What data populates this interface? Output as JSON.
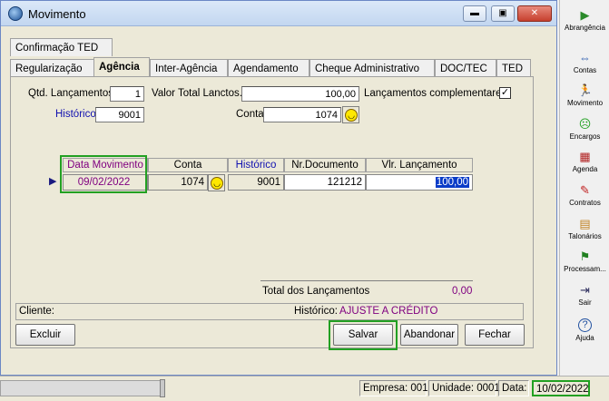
{
  "window": {
    "title": "Movimento",
    "buttons": {
      "minimize": "▬",
      "maximize": "▣",
      "close": "✕"
    }
  },
  "tabs_row1": [
    {
      "label": "Confirmação TED"
    }
  ],
  "tabs_row2": [
    {
      "label": "Regularização"
    },
    {
      "label": "Agência"
    },
    {
      "label": "Inter-Agência"
    },
    {
      "label": "Agendamento"
    },
    {
      "label": "Cheque Administrativo"
    },
    {
      "label": "DOC/TEC"
    },
    {
      "label": "TED"
    }
  ],
  "form": {
    "qtd_label": "Qtd. Lançamentos",
    "qtd_value": "1",
    "valor_label": "Valor Total Lanctos.",
    "valor_value": "100,00",
    "complementares_label": "Lançamentos complementares",
    "complementares_checked": "✓",
    "historico_label": "Histórico",
    "historico_value": "9001",
    "conta_label": "Conta",
    "conta_value": "1074"
  },
  "grid": {
    "headers": [
      "Data Movimento",
      "Conta",
      "Histórico",
      "Nr.Documento",
      "Vlr. Lançamento"
    ],
    "row": {
      "data": "09/02/2022",
      "conta": "1074",
      "historico": "9001",
      "nr_documento": "121212",
      "vlr": "100,00"
    },
    "row_indicator": "▶"
  },
  "total": {
    "label": "Total dos Lançamentos",
    "value": "0,00"
  },
  "cliente": {
    "label": "Cliente:",
    "historico_label": "Histórico:",
    "historico_value": "AJUSTE A CRÉDITO"
  },
  "buttons": {
    "excluir": "Excluir",
    "salvar": "Salvar",
    "abandonar": "Abandonar",
    "fechar": "Fechar"
  },
  "sidebar": [
    {
      "label": "Abrangência",
      "icon": "abrangencia-icon",
      "glyph": "▶",
      "color": "#2a8a2a"
    },
    {
      "label": "Contas",
      "icon": "contas-icon",
      "glyph": "⇔",
      "color": "#3060b0"
    },
    {
      "label": "Movimento",
      "icon": "movimento-icon",
      "glyph": "🏃",
      "color": "#1a1a80"
    },
    {
      "label": "Encargos",
      "icon": "encargos-icon",
      "glyph": "☹",
      "color": "#20a020"
    },
    {
      "label": "Agenda",
      "icon": "agenda-icon",
      "glyph": "▦",
      "color": "#b02020"
    },
    {
      "label": "Contratos",
      "icon": "contratos-icon",
      "glyph": "✎",
      "color": "#c02020"
    },
    {
      "label": "Talonários",
      "icon": "talonarios-icon",
      "glyph": "▤",
      "color": "#c08020"
    },
    {
      "label": "Processam...",
      "icon": "processamento-icon",
      "glyph": "⚑",
      "color": "#208020"
    },
    {
      "label": "Sair",
      "icon": "sair-icon",
      "glyph": "⇥",
      "color": "#303060"
    },
    {
      "label": "Ajuda",
      "icon": "ajuda-icon",
      "glyph": "?",
      "color": "#2050a0"
    }
  ],
  "status": {
    "empresa": "Empresa: 001",
    "unidade": "Unidade: 0001",
    "data_label": "Data:",
    "data_value": "10/02/2022"
  },
  "colors": {
    "highlight": "#22a022",
    "grid_header_accent": "#800080",
    "link_blue": "#1010b0"
  }
}
